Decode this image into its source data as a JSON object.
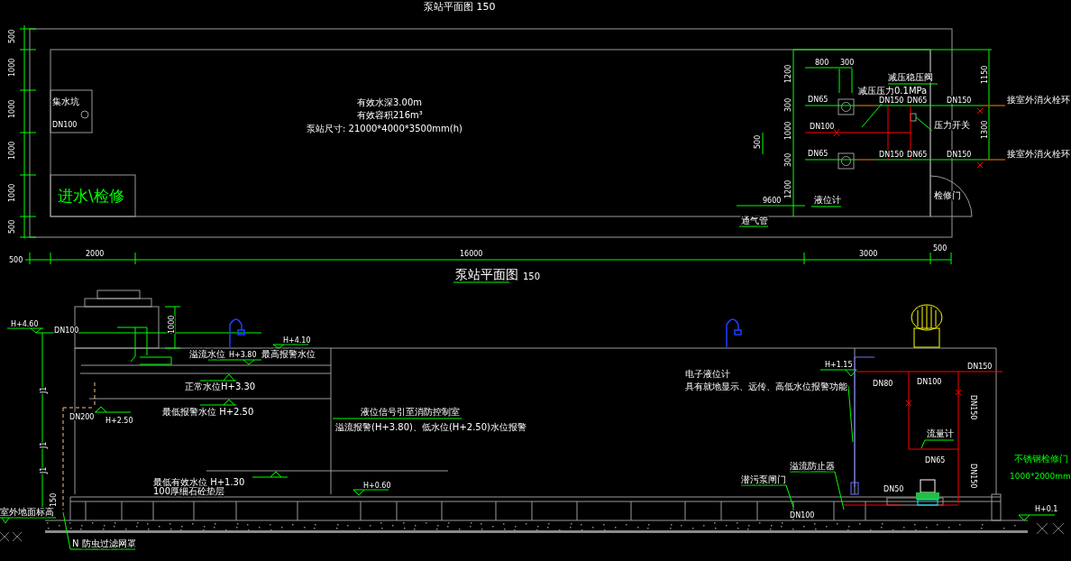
{
  "plan": {
    "texts": [
      {
        "text": "泵站平面图 150",
        "kind": "title"
      },
      {
        "text": "500",
        "kind": "dim"
      },
      {
        "text": "1000",
        "kind": "dim"
      },
      {
        "text": "1000",
        "kind": "dim"
      },
      {
        "text": "1000",
        "kind": "dim"
      },
      {
        "text": "1000",
        "kind": "dim"
      },
      {
        "text": "500",
        "kind": "dim"
      },
      {
        "text": "500",
        "kind": "dim"
      },
      {
        "text": "2000",
        "kind": "dim"
      },
      {
        "text": "16000",
        "kind": "dim"
      },
      {
        "text": "3000",
        "kind": "dim"
      },
      {
        "text": "500",
        "kind": "dim"
      },
      {
        "text": "集水坑",
        "kind": "label"
      },
      {
        "text": "DN100",
        "kind": "dim"
      },
      {
        "text": "有效水深3.00m",
        "kind": "label"
      },
      {
        "text": "有效容积216m³",
        "kind": "label"
      },
      {
        "text": "泵站尺寸: 21000*4000*3500mm(h)",
        "kind": "label"
      },
      {
        "text": "进水\\检修",
        "kind": "accent"
      },
      {
        "text": "800",
        "kind": "dim"
      },
      {
        "text": "300",
        "kind": "dim"
      },
      {
        "text": "1200",
        "kind": "dim"
      },
      {
        "text": "300",
        "kind": "dim"
      },
      {
        "text": "1000",
        "kind": "dim"
      },
      {
        "text": "500",
        "kind": "dim"
      },
      {
        "text": "300",
        "kind": "dim"
      },
      {
        "text": "1200",
        "kind": "dim"
      },
      {
        "text": "1150",
        "kind": "dim"
      },
      {
        "text": "1300",
        "kind": "dim"
      },
      {
        "text": "DN65",
        "kind": "dim"
      },
      {
        "text": "DN100",
        "kind": "dim"
      },
      {
        "text": "DN65",
        "kind": "dim"
      },
      {
        "text": "DN150",
        "kind": "dim"
      },
      {
        "text": "DN65",
        "kind": "dim"
      },
      {
        "text": "DN150",
        "kind": "dim"
      },
      {
        "text": "DN65",
        "kind": "dim"
      },
      {
        "text": "DN150",
        "kind": "dim"
      },
      {
        "text": "DN150",
        "kind": "dim"
      },
      {
        "text": "减压稳压阀",
        "kind": "label"
      },
      {
        "text": "减压压力0.1MPa",
        "kind": "label"
      },
      {
        "text": "压力开关",
        "kind": "label"
      },
      {
        "text": "接室外消火栓环",
        "kind": "label"
      },
      {
        "text": "接室外消火栓环",
        "kind": "label"
      },
      {
        "text": "液位计",
        "kind": "label"
      },
      {
        "text": "检修门",
        "kind": "label"
      },
      {
        "text": "通气管",
        "kind": "label"
      },
      {
        "text": "9600",
        "kind": "dim"
      },
      {
        "text": "泵站平面图",
        "kind": "title"
      },
      {
        "text": "150",
        "kind": "dim"
      }
    ]
  },
  "section": {
    "texts": [
      {
        "text": "H+4.60",
        "kind": "dim"
      },
      {
        "text": "DN100",
        "kind": "dim"
      },
      {
        "text": "1000",
        "kind": "dim"
      },
      {
        "text": "H+4.10",
        "kind": "dim"
      },
      {
        "text": "溢流水位",
        "kind": "label"
      },
      {
        "text": "H+3.80",
        "kind": "dim"
      },
      {
        "text": "最高报警水位",
        "kind": "label"
      },
      {
        "text": "正常水位H+3.30",
        "kind": "label"
      },
      {
        "text": "最低报警水位 H+2.50",
        "kind": "label"
      },
      {
        "text": "DN200",
        "kind": "dim"
      },
      {
        "text": "H+2.50",
        "kind": "dim"
      },
      {
        "text": "液位信号引至消防控制室",
        "kind": "label"
      },
      {
        "text": "溢流报警(H+3.80)、低水位(H+2.50)水位报警",
        "kind": "label"
      },
      {
        "text": "最低有效水位 H+1.30",
        "kind": "label"
      },
      {
        "text": "100厚细石砼垫层",
        "kind": "label"
      },
      {
        "text": "H+0.60",
        "kind": "dim"
      },
      {
        "text": "室外地面标高",
        "kind": "label"
      },
      {
        "text": "150",
        "kind": "dim"
      },
      {
        "text": "J1",
        "kind": "dim"
      },
      {
        "text": "J1",
        "kind": "dim"
      },
      {
        "text": "J1",
        "kind": "dim"
      },
      {
        "text": "N 防虫过滤网罩",
        "kind": "label"
      },
      {
        "text": "H+1.15",
        "kind": "dim"
      },
      {
        "text": "电子液位计",
        "kind": "label"
      },
      {
        "text": "具有就地显示、远传、高低水位报警功能",
        "kind": "label"
      },
      {
        "text": "DN80",
        "kind": "dim"
      },
      {
        "text": "DN100",
        "kind": "dim"
      },
      {
        "text": "DN150",
        "kind": "dim"
      },
      {
        "text": "DN150",
        "kind": "dim"
      },
      {
        "text": "流量计",
        "kind": "label"
      },
      {
        "text": "DN65",
        "kind": "dim"
      },
      {
        "text": "DN150",
        "kind": "dim"
      },
      {
        "text": "DN50",
        "kind": "dim"
      },
      {
        "text": "溢流防止器",
        "kind": "label"
      },
      {
        "text": "潜污泵闸门",
        "kind": "label"
      },
      {
        "text": "DN100",
        "kind": "dim"
      },
      {
        "text": "不锈钢检修门",
        "kind": "accent"
      },
      {
        "text": "1000*2000mm",
        "kind": "accent"
      },
      {
        "text": "H+0.1",
        "kind": "dim"
      }
    ]
  }
}
